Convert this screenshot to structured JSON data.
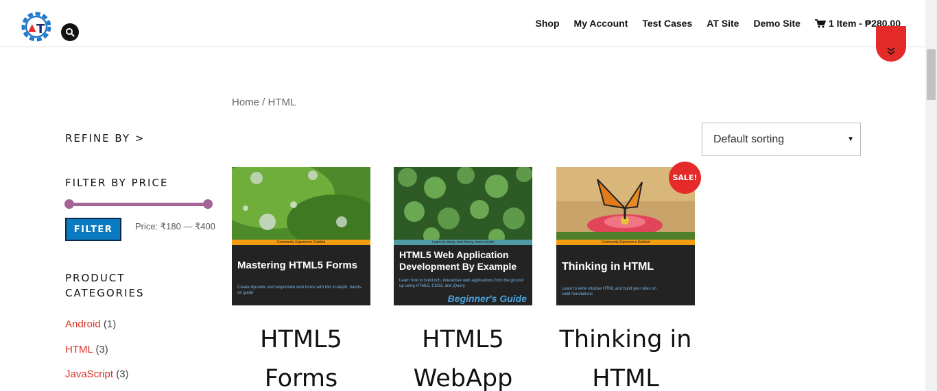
{
  "header": {
    "logo_letters": "AT",
    "nav": [
      {
        "label": "Shop"
      },
      {
        "label": "My Account"
      },
      {
        "label": "Test Cases"
      },
      {
        "label": "AT Site"
      },
      {
        "label": "Demo Site"
      }
    ],
    "cart_label": "1 Item - ₱280.00"
  },
  "breadcrumb": {
    "home": "Home",
    "separator": " / ",
    "current": "HTML"
  },
  "sorting": {
    "selected": "Default sorting"
  },
  "sidebar": {
    "refine_title": "REFINE BY >",
    "price_title": "FILTER BY PRICE",
    "price_range": {
      "min": 180,
      "max": 400,
      "selected_min": 180,
      "selected_max": 400
    },
    "filter_button": "FILTER",
    "price_label": "Price: ₹180 — ₹400",
    "categories_title_line1": "PRODUCT",
    "categories_title_line2": "CATEGORIES",
    "categories": [
      {
        "name": "Android",
        "count": "(1)"
      },
      {
        "name": "HTML",
        "count": "(3)"
      },
      {
        "name": "JavaScript",
        "count": "(3)"
      }
    ]
  },
  "products": [
    {
      "cover_title": "Mastering HTML5 Forms",
      "cover_tagline": "Community Experience Distilled",
      "cover_desc": "Create dynamic and responsive web forms with this in-depth, hands-on guide",
      "title_line1": "HTML5",
      "title_line2": "Forms",
      "sale": false
    },
    {
      "cover_title": "HTML5 Web Application Development By Example",
      "cover_tagline": "Learn by doing: less theory, more results",
      "cover_desc": "Learn how to build rich, interactive web applications from the ground up using HTML5, CSS3, and jQuery",
      "cover_guide": "Beginner's Guide",
      "title_line1": "HTML5",
      "title_line2": "WebApp",
      "sale": false
    },
    {
      "cover_title": "Thinking in HTML",
      "cover_tagline": "Community Experience Distilled",
      "cover_desc": "Learn to write intuitive HTML and build your sites on solid foundations",
      "title_line1": "Thinking in",
      "title_line2": "HTML",
      "sale": true,
      "sale_label": "SALE!"
    }
  ],
  "colors": {
    "accent_red": "#e52a2a",
    "link_red": "#d93025",
    "slider_purple": "#a46497",
    "filter_blue": "#0b7bc1",
    "logo_blue": "#1f78c8"
  }
}
